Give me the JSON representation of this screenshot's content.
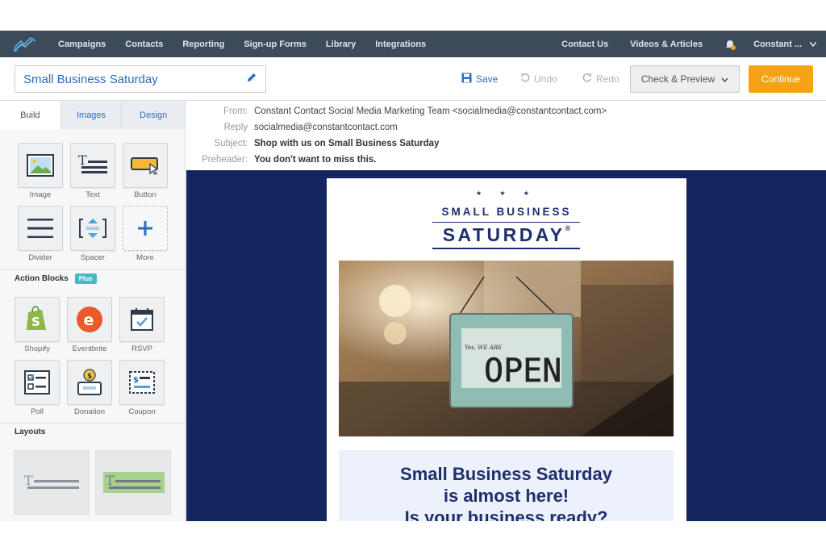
{
  "nav": {
    "items": [
      "Campaigns",
      "Contacts",
      "Reporting",
      "Sign-up Forms",
      "Library",
      "Integrations"
    ],
    "right_items": [
      "Contact Us",
      "Videos & Articles"
    ],
    "account": "Constant ..."
  },
  "toolbar": {
    "title": "Small Business Saturday",
    "save_label": "Save",
    "undo_label": "Undo",
    "redo_label": "Redo",
    "check_label": "Check & Preview",
    "continue_label": "Continue",
    "accent": "#2a6fbd",
    "continue_color": "#f5a214"
  },
  "sidebar": {
    "tabs": [
      "Build",
      "Images",
      "Design"
    ],
    "active_tab": "Build",
    "blocks": [
      "Image",
      "Text",
      "Button",
      "Divider",
      "Spacer",
      "More"
    ],
    "action_blocks_heading": "Action Blocks",
    "plus_badge": "Plus",
    "action_blocks": [
      "Shopify",
      "Eventbrite",
      "RSVP",
      "Poll",
      "Donation",
      "Coupon"
    ],
    "layouts_heading": "Layouts"
  },
  "email_meta": {
    "from_label": "From:",
    "from_value": "Constant Contact Social Media Marketing Team <socialmedia@constantcontact.com>",
    "reply_label": "Reply",
    "reply_value": "socialmedia@constantcontact.com",
    "subject_label": "Subject:",
    "subject_value": "Shop with us on Small Business Saturday",
    "preheader_label": "Preheader:",
    "preheader_value": "You don't want to miss this."
  },
  "email": {
    "stars": "★ ★ ★",
    "logo_line1": "SMALL BUSINESS",
    "logo_line2": "SATURDAY",
    "logo_reg": "®",
    "sign_small": "Yes, WE ARE",
    "sign_text": "OPEN",
    "headline": [
      "Small Business Saturday",
      "is almost here!",
      "Is your business ready?"
    ],
    "background_color": "#13265e",
    "brand_navy": "#1e2f6b"
  }
}
